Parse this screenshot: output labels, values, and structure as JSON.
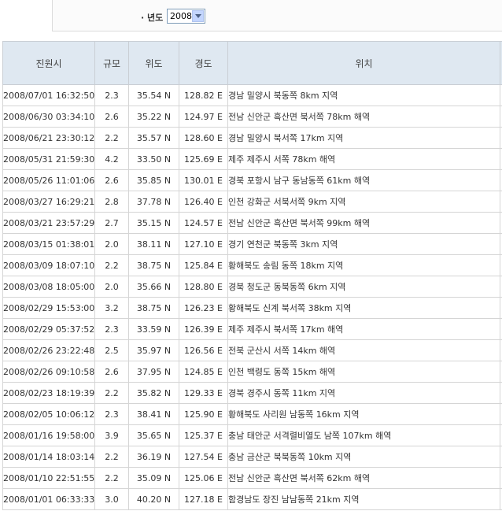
{
  "filter": {
    "label": "· 년도",
    "year": "2008"
  },
  "headers": {
    "time": "진원시",
    "magnitude": "규모",
    "latitude": "위도",
    "longitude": "경도",
    "location": "위치"
  },
  "rows": [
    {
      "time": "2008/07/01 16:32:50",
      "magnitude": "2.3",
      "latitude": "35.54 N",
      "longitude": "128.82 E",
      "location": "경남 밀양시 북동쪽 8km 지역"
    },
    {
      "time": "2008/06/30 03:34:10",
      "magnitude": "2.6",
      "latitude": "35.22 N",
      "longitude": "124.97 E",
      "location": "전남 신안군 흑산면 북서쪽 78km 해역"
    },
    {
      "time": "2008/06/21 23:30:12",
      "magnitude": "2.2",
      "latitude": "35.57 N",
      "longitude": "128.60 E",
      "location": "경남 밀양시 북서쪽 17km 지역"
    },
    {
      "time": "2008/05/31 21:59:30",
      "magnitude": "4.2",
      "latitude": "33.50 N",
      "longitude": "125.69 E",
      "location": "제주 제주시 서쪽 78km 해역"
    },
    {
      "time": "2008/05/26 11:01:06",
      "magnitude": "2.6",
      "latitude": "35.85 N",
      "longitude": "130.01 E",
      "location": "경북 포항시 남구 동남동쪽 61km 해역"
    },
    {
      "time": "2008/03/27 16:29:21",
      "magnitude": "2.8",
      "latitude": "37.78 N",
      "longitude": "126.40 E",
      "location": "인천 강화군 서북서쪽 9km 지역"
    },
    {
      "time": "2008/03/21 23:57:29",
      "magnitude": "2.7",
      "latitude": "35.15 N",
      "longitude": "124.57 E",
      "location": "전남 신안군 흑산면 북서쪽 99km 해역"
    },
    {
      "time": "2008/03/15 01:38:01",
      "magnitude": "2.0",
      "latitude": "38.11 N",
      "longitude": "127.10 E",
      "location": "경기 연천군 북동쪽 3km 지역"
    },
    {
      "time": "2008/03/09 18:07:10",
      "magnitude": "2.2",
      "latitude": "38.75 N",
      "longitude": "125.84 E",
      "location": "황해북도 송림 동쪽 18km 지역"
    },
    {
      "time": "2008/03/08 18:05:00",
      "magnitude": "2.0",
      "latitude": "35.66 N",
      "longitude": "128.80 E",
      "location": "경북 청도군 동북동쪽 6km 지역"
    },
    {
      "time": "2008/02/29 15:53:00",
      "magnitude": "3.2",
      "latitude": "38.75 N",
      "longitude": "126.23 E",
      "location": "황해북도 신계 북서쪽 38km 지역"
    },
    {
      "time": "2008/02/29 05:37:52",
      "magnitude": "2.3",
      "latitude": "33.59 N",
      "longitude": "126.39 E",
      "location": "제주 제주시 북서쪽 17km 해역"
    },
    {
      "time": "2008/02/26 23:22:48",
      "magnitude": "2.5",
      "latitude": "35.97 N",
      "longitude": "126.56 E",
      "location": "전북 군산시 서쪽 14km 해역"
    },
    {
      "time": "2008/02/26 09:10:58",
      "magnitude": "2.6",
      "latitude": "37.95 N",
      "longitude": "124.85 E",
      "location": "인천 백령도 동쪽 15km 해역"
    },
    {
      "time": "2008/02/23 18:19:39",
      "magnitude": "2.2",
      "latitude": "35.82 N",
      "longitude": "129.33 E",
      "location": "경북 경주시 동쪽 11km 지역"
    },
    {
      "time": "2008/02/05 10:06:12",
      "magnitude": "2.3",
      "latitude": "38.41 N",
      "longitude": "125.90 E",
      "location": "황해북도 사리원 남동쪽 16km 지역"
    },
    {
      "time": "2008/01/16 19:58:00",
      "magnitude": "3.9",
      "latitude": "35.65 N",
      "longitude": "125.37 E",
      "location": "충남 태안군 서격렬비열도 남쪽 107km 해역"
    },
    {
      "time": "2008/01/14 18:03:14",
      "magnitude": "2.2",
      "latitude": "36.19 N",
      "longitude": "127.54 E",
      "location": "충남 금산군 북북동쪽 10km 지역"
    },
    {
      "time": "2008/01/10 22:51:55",
      "magnitude": "2.2",
      "latitude": "35.09 N",
      "longitude": "125.06 E",
      "location": "전남 신안군 흑산면 북서쪽 62km 해역"
    },
    {
      "time": "2008/01/01 06:33:33",
      "magnitude": "3.0",
      "latitude": "40.20 N",
      "longitude": "127.18 E",
      "location": "함경남도 장진 남남동쪽 21km 지역"
    }
  ]
}
